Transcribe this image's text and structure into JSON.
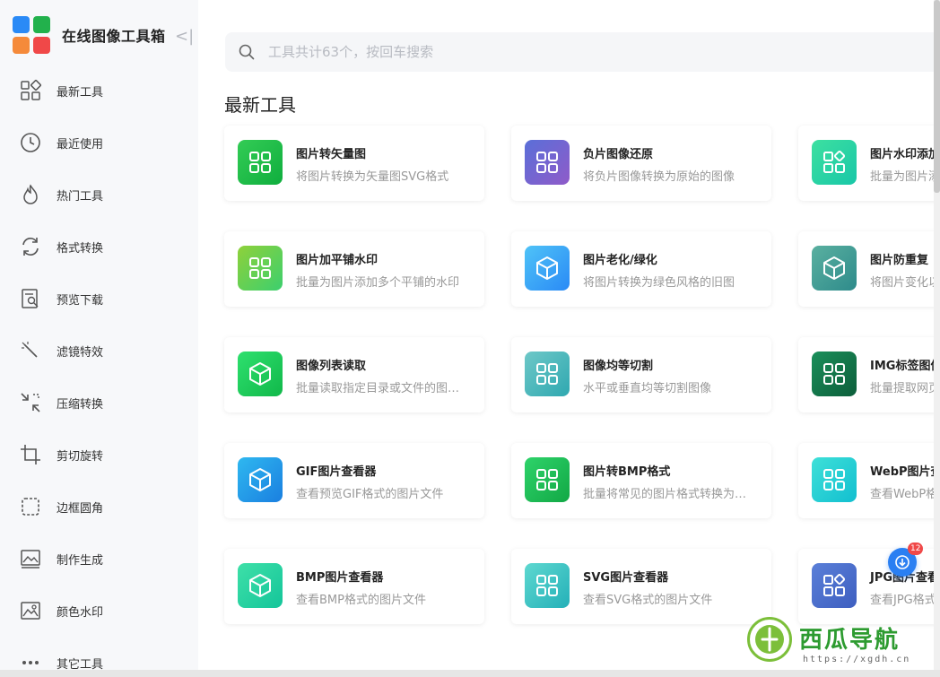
{
  "app": {
    "title": "在线图像工具箱",
    "collapse_icon": "collapse-icon",
    "logo_colors": [
      "#2a8af6",
      "#22b14c",
      "#f58a3a",
      "#f04848"
    ]
  },
  "sidebar": {
    "items": [
      {
        "label": "最新工具",
        "icon": "grid-icon"
      },
      {
        "label": "最近使用",
        "icon": "clock-icon"
      },
      {
        "label": "热门工具",
        "icon": "flame-icon"
      },
      {
        "label": "格式转换",
        "icon": "refresh-icon"
      },
      {
        "label": "预览下载",
        "icon": "preview-icon"
      },
      {
        "label": "滤镜特效",
        "icon": "magic-wand-icon"
      },
      {
        "label": "压缩转换",
        "icon": "compress-icon"
      },
      {
        "label": "剪切旋转",
        "icon": "crop-icon"
      },
      {
        "label": "边框圆角",
        "icon": "border-icon"
      },
      {
        "label": "制作生成",
        "icon": "image-icon"
      },
      {
        "label": "颜色水印",
        "icon": "watermark-icon"
      },
      {
        "label": "其它工具",
        "icon": "more-icon"
      }
    ]
  },
  "search": {
    "placeholder": "工具共计63个，按回车搜索",
    "icon": "search-icon"
  },
  "section": {
    "title": "最新工具"
  },
  "tools": [
    {
      "title": "图片转矢量图",
      "desc": "将图片转换为矢量图SVG格式",
      "icon": "grid",
      "c1": "#33cc55",
      "c2": "#0fae3e"
    },
    {
      "title": "负片图像还原",
      "desc": "将负片图像转换为原始的图像",
      "icon": "grid",
      "c1": "#5a6fd8",
      "c2": "#8f5bc9"
    },
    {
      "title": "图片水印添加",
      "desc": "批量为图片添加水印",
      "icon": "shapes",
      "c1": "#3de0a0",
      "c2": "#19c7a8"
    },
    {
      "title": "图片加平铺水印",
      "desc": "批量为图片添加多个平铺的水印",
      "icon": "grid",
      "c1": "#8fd13a",
      "c2": "#3ccf6e"
    },
    {
      "title": "图片老化/绿化",
      "desc": "将图片转换为绿色风格的旧图",
      "icon": "cube",
      "c1": "#4fc3f7",
      "c2": "#2a8af6"
    },
    {
      "title": "图片防重复",
      "desc": "将图片变化以防止重复",
      "icon": "cube",
      "c1": "#5ab0a0",
      "c2": "#2e8b8b"
    },
    {
      "title": "图像列表读取",
      "desc": "批量读取指定目录或文件的图像列表",
      "icon": "cube",
      "c1": "#2ee06e",
      "c2": "#11b84a"
    },
    {
      "title": "图像均等切割",
      "desc": "水平或垂直均等切割图像",
      "icon": "grid",
      "c1": "#6ec8c8",
      "c2": "#2fa8b0"
    },
    {
      "title": "IMG标签图像",
      "desc": "批量提取网页图像",
      "icon": "grid",
      "c1": "#1a8f5a",
      "c2": "#0d5e3b"
    },
    {
      "title": "GIF图片查看器",
      "desc": "查看预览GIF格式的图片文件",
      "icon": "cube",
      "c1": "#2fb8f0",
      "c2": "#1a7fe0"
    },
    {
      "title": "图片转BMP格式",
      "desc": "批量将常见的图片格式转换为BMP格式",
      "icon": "grid",
      "c1": "#2ed36a",
      "c2": "#12a845"
    },
    {
      "title": "WebP图片查看器",
      "desc": "查看WebP格式的图片文件",
      "icon": "grid",
      "c1": "#3ee0d8",
      "c2": "#12bfd0"
    },
    {
      "title": "BMP图片查看器",
      "desc": "查看BMP格式的图片文件",
      "icon": "cube",
      "c1": "#3ee0a8",
      "c2": "#14c59a"
    },
    {
      "title": "SVG图片查看器",
      "desc": "查看SVG格式的图片文件",
      "icon": "grid",
      "c1": "#5ed8d0",
      "c2": "#24b0b8"
    },
    {
      "title": "JPG图片查看器",
      "desc": "查看JPG格式的图片文件",
      "icon": "shapes",
      "c1": "#5a7fd8",
      "c2": "#3e5fc0"
    }
  ],
  "notification": {
    "badge": "12",
    "icon": "download-icon"
  },
  "watermark": {
    "text": "西瓜导航",
    "url": "https://xgdh.cn"
  }
}
